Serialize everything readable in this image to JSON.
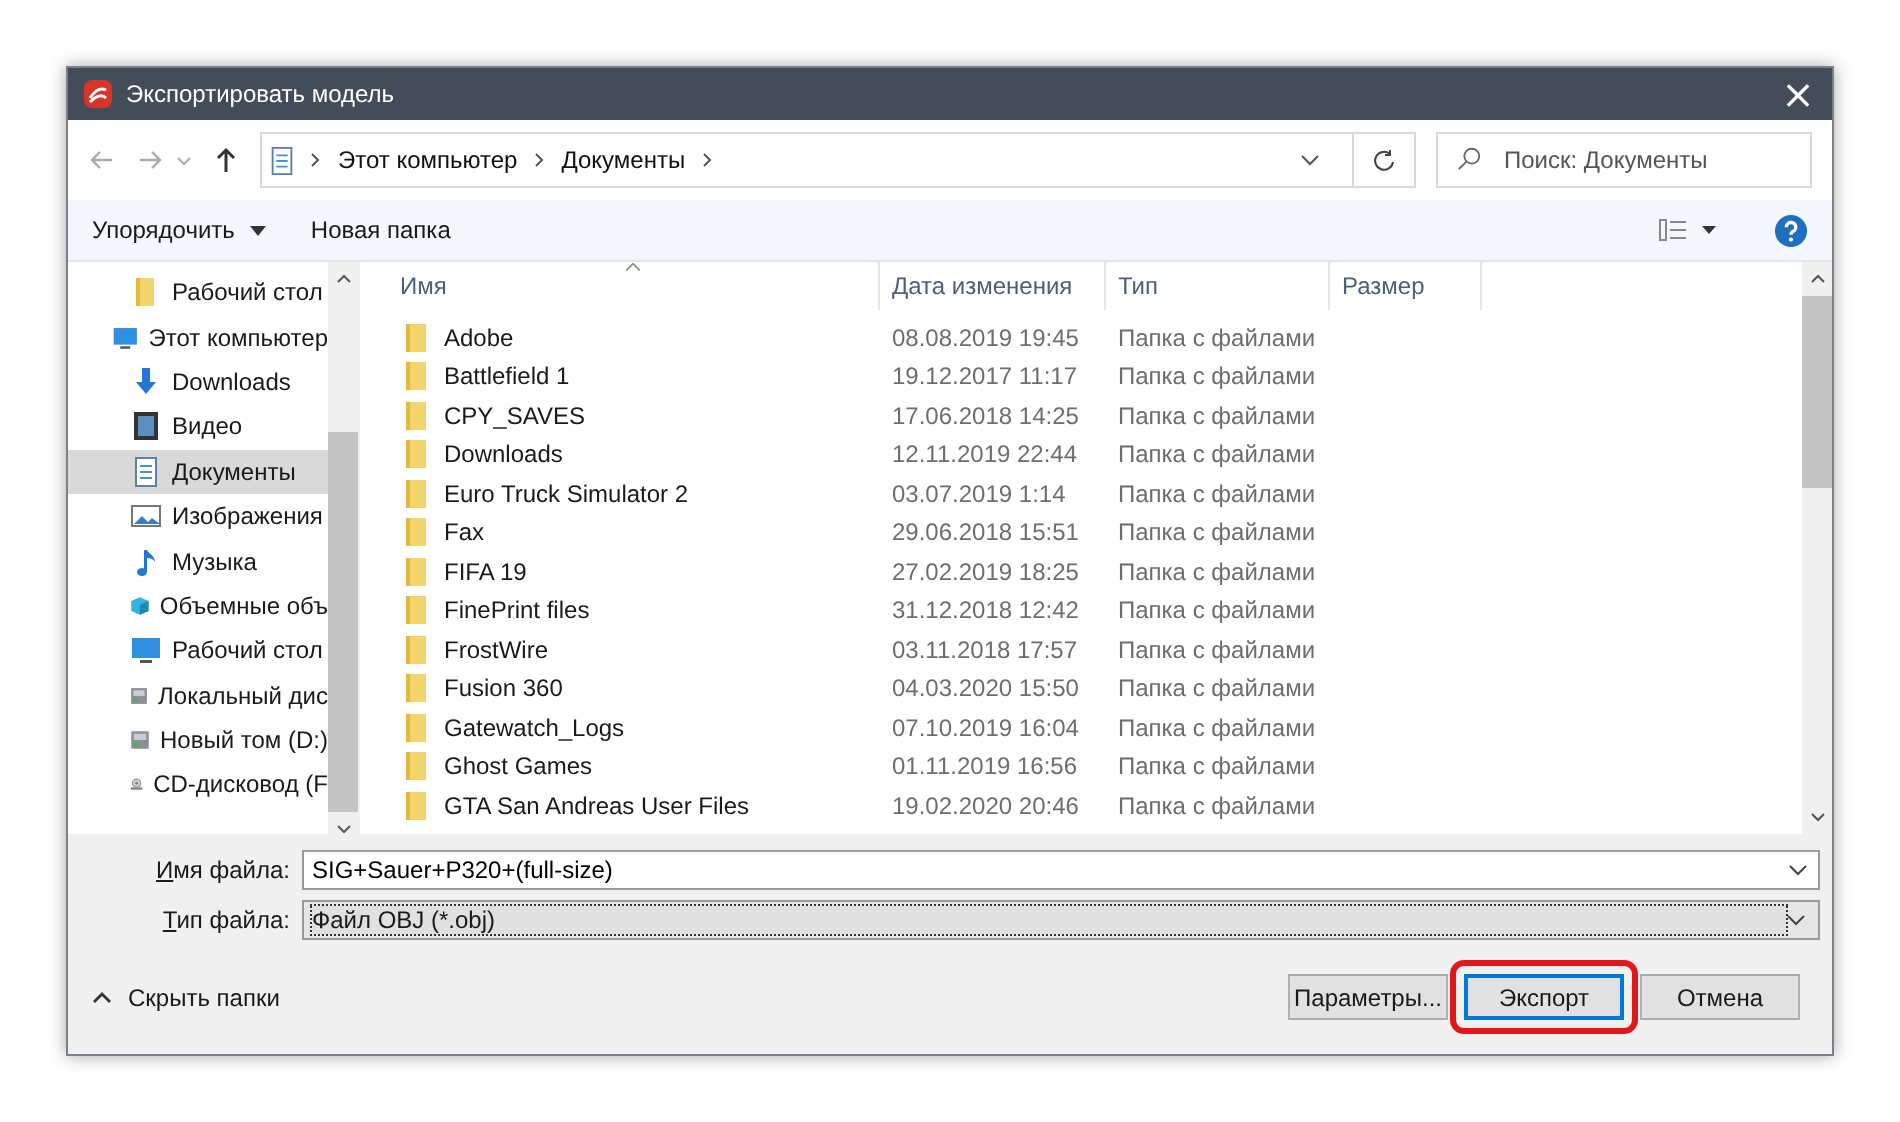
{
  "window": {
    "title": "Экспортировать модель",
    "close": "×"
  },
  "address": {
    "path": [
      "Этот компьютер",
      "Документы"
    ],
    "search_placeholder": "Поиск: Документы"
  },
  "toolbar": {
    "organize": "Упорядочить",
    "new_folder": "Новая папка"
  },
  "sidebar": {
    "items": [
      {
        "label": "Рабочий стол",
        "selected": false
      },
      {
        "label": "Этот компьютер",
        "selected": false,
        "children": [
          {
            "label": "Downloads",
            "selected": false
          },
          {
            "label": "Видео",
            "selected": false
          },
          {
            "label": "Документы",
            "selected": true
          },
          {
            "label": "Изображения",
            "selected": false
          },
          {
            "label": "Музыка",
            "selected": false
          },
          {
            "label": "Объемные объ",
            "selected": false
          },
          {
            "label": "Рабочий стол",
            "selected": false
          },
          {
            "label": "Локальный дис",
            "selected": false
          },
          {
            "label": "Новый том (D:)",
            "selected": false
          },
          {
            "label": "CD-дисковод (F",
            "selected": false
          }
        ]
      }
    ]
  },
  "table": {
    "columns": [
      "Имя",
      "Дата изменения",
      "Тип",
      "Размер"
    ],
    "rows": [
      {
        "name": "Adobe",
        "date": "08.08.2019 19:45",
        "type": "Папка с файлами"
      },
      {
        "name": "Battlefield 1",
        "date": "19.12.2017 11:17",
        "type": "Папка с файлами"
      },
      {
        "name": "CPY_SAVES",
        "date": "17.06.2018 14:25",
        "type": "Папка с файлами"
      },
      {
        "name": "Downloads",
        "date": "12.11.2019 22:44",
        "type": "Папка с файлами"
      },
      {
        "name": "Euro Truck Simulator 2",
        "date": "03.07.2019 1:14",
        "type": "Папка с файлами"
      },
      {
        "name": "Fax",
        "date": "29.06.2018 15:51",
        "type": "Папка с файлами"
      },
      {
        "name": "FIFA 19",
        "date": "27.02.2019 18:25",
        "type": "Папка с файлами"
      },
      {
        "name": "FinePrint files",
        "date": "31.12.2018 12:42",
        "type": "Папка с файлами"
      },
      {
        "name": "FrostWire",
        "date": "03.11.2018 17:57",
        "type": "Папка с файлами"
      },
      {
        "name": "Fusion 360",
        "date": "04.03.2020 15:50",
        "type": "Папка с файлами"
      },
      {
        "name": "Gatewatch_Logs",
        "date": "07.10.2019 16:04",
        "type": "Папка с файлами"
      },
      {
        "name": "Ghost Games",
        "date": "01.11.2019 16:56",
        "type": "Папка с файлами"
      },
      {
        "name": "GTA San Andreas User Files",
        "date": "19.02.2020 20:46",
        "type": "Папка с файлами"
      }
    ]
  },
  "file_name": {
    "label": "Имя файла:",
    "value": "SIG+Sauer+P320+(full-size)"
  },
  "file_type": {
    "label": "Тип файла:",
    "value": "Файл OBJ (*.obj)"
  },
  "hide_folders": "Скрыть папки",
  "buttons": [
    {
      "label": "Параметры...",
      "default": false
    },
    {
      "label": "Экспорт",
      "default": true
    },
    {
      "label": "Отмена",
      "default": false
    }
  ]
}
